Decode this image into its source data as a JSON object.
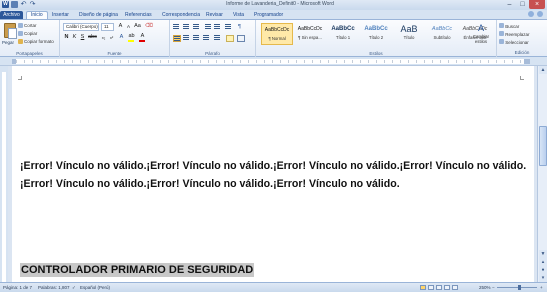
{
  "window": {
    "title": "Informe de Lavanderia_Definit0 - Microsoft Word",
    "app_letter": "W"
  },
  "tabs": {
    "file": "Archivo",
    "items": [
      "Inicio",
      "Insertar",
      "Diseño de página",
      "Referencias",
      "Correspondencia",
      "Revisar",
      "Vista",
      "Programador"
    ],
    "active": "Inicio"
  },
  "ribbon": {
    "clipboard": {
      "paste": "Pegar",
      "cut": "Cortar",
      "copy": "Copiar",
      "format_painter": "Copiar formato",
      "group": "Portapapeles"
    },
    "font": {
      "family": "Calibri (Cuerpo)",
      "size": "11",
      "group": "Fuente"
    },
    "paragraph": {
      "group": "Párrafo"
    },
    "styles": {
      "group": "Estilos",
      "items": [
        {
          "preview": "AaBbCcDc",
          "name": "¶ Normal"
        },
        {
          "preview": "AaBbCcDc",
          "name": "¶ Sin espa..."
        },
        {
          "preview": "AaBbCc",
          "name": "Título 1"
        },
        {
          "preview": "AaBbCc",
          "name": "Título 2"
        },
        {
          "preview": "AaB",
          "name": "Título"
        },
        {
          "preview": "AaBbCc",
          "name": "Subtítulo"
        },
        {
          "preview": "AaBbCcDc",
          "name": "Énfasis sutil"
        }
      ],
      "change": "Cambiar estilos"
    },
    "editing": {
      "find": "Buscar",
      "replace": "Reemplazar",
      "select": "Seleccionar",
      "group": "Edición"
    }
  },
  "document": {
    "toc_error": "¡Error! Vínculo no válido.¡Error! Vínculo no válido.¡Error! Vínculo no válido.¡Error! Vínculo no válido.¡Error! Vínculo no válido.¡Error! Vínculo no válido.¡Error! Vínculo no válido.",
    "heading": "CONTROLADOR PRIMARIO DE SEGURIDAD"
  },
  "status": {
    "page": "Página: 1 de 7",
    "words": "Palabras: 1,807",
    "language": "Español (Perú)",
    "zoom": "250%"
  }
}
